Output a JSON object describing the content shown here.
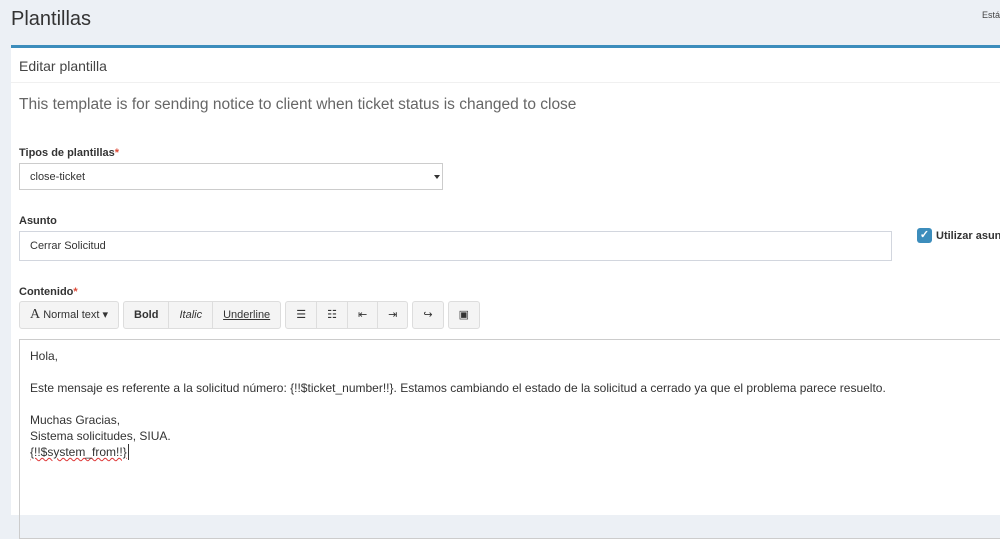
{
  "page": {
    "title": "Plantillas",
    "breadcrumb": "Estás aquí"
  },
  "box": {
    "title": "Editar plantilla",
    "description": "This template is for sending notice to client when ticket status is changed to close"
  },
  "template_type": {
    "label": "Tipos de plantillas",
    "required": "*",
    "value": "close-ticket"
  },
  "subject": {
    "label": "Asunto",
    "value": "Cerrar Solicitud",
    "checkbox_label": "Utilizar asunto",
    "checked": true
  },
  "content": {
    "label": "Contenido",
    "required": "*",
    "toolbar": {
      "normal_text": "Normal text",
      "bold": "Bold",
      "italic": "Italic",
      "underline": "Underline"
    },
    "lines": [
      "Hola,",
      "",
      "Este mensaje es referente a la solicitud número:  {!!$ticket_number!!}. Estamos cambiando el estado de la solicitud a cerrado ya que el problema parece resuelto.",
      "",
      "Muchas Gracias,",
      "Sistema solicitudes, SIUA.",
      "{!!$system_from!!}"
    ]
  },
  "colors": {
    "accent": "#3c8dbc",
    "background": "#ecf0f5"
  }
}
